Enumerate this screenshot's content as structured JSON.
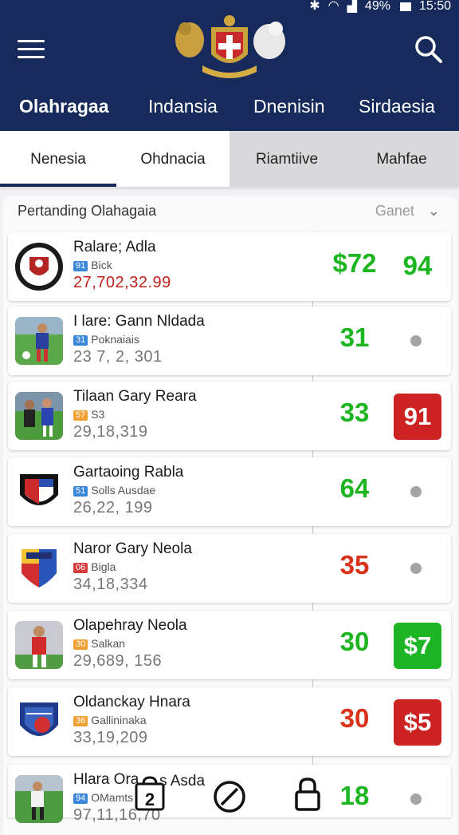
{
  "status": {
    "battery": "49%",
    "time": "15:50"
  },
  "header": {
    "menu_icon": "menu-icon",
    "search_icon": "search-icon",
    "crest_icon": "coat-of-arms",
    "tabs": [
      {
        "label": "Olahragaa",
        "active": true
      },
      {
        "label": "Indansia",
        "active": false
      },
      {
        "label": "Dnenisin",
        "active": false
      },
      {
        "label": "Sirdaesia",
        "active": false
      }
    ]
  },
  "subtabs": [
    {
      "label": "Nenesia",
      "active": true
    },
    {
      "label": "Ohdnacia",
      "active": false
    },
    {
      "label": "Riamtiive",
      "active": false
    },
    {
      "label": "Mahfae",
      "active": false
    }
  ],
  "panel": {
    "title": "Pertanding Olahagaia",
    "filter_label": "Ganet"
  },
  "rows": [
    {
      "name": "Ralare; Adla",
      "tag": "91",
      "tag_color": "#3a86d9",
      "sub": "Bick",
      "value": "27,702,32.99",
      "score": "$72",
      "score_color": "green",
      "right": "94",
      "right_type": "text",
      "logo": "club-crest"
    },
    {
      "name": "I lare: Gann Nldada",
      "tag": "31",
      "tag_color": "#3a86d9",
      "sub": "Poknaiais",
      "value": "23 7, 2, 301",
      "score": "31",
      "score_color": "green",
      "right": "",
      "right_type": "dot",
      "logo": "player-photo"
    },
    {
      "name": "Tilaan Gary Reara",
      "tag": "57",
      "tag_color": "#f0a030",
      "sub": "S3",
      "value": "29,18,319",
      "score": "33",
      "score_color": "green",
      "right": "91",
      "right_type": "badge-red",
      "logo": "player-photo"
    },
    {
      "name": "Gartaoing Rabla",
      "tag": "51",
      "tag_color": "#3a86d9",
      "sub": "Solls Ausdae",
      "value": "26,22, 199",
      "score": "64",
      "score_color": "green",
      "right": "",
      "right_type": "dot",
      "logo": "shield-crest"
    },
    {
      "name": "Naror Gary Neola",
      "tag": "06",
      "tag_color": "#d93a3a",
      "sub": "Bigla",
      "value": "34,18,334",
      "score": "35",
      "score_color": "red",
      "right": "",
      "right_type": "dot",
      "logo": "colorful-crest"
    },
    {
      "name": "Olapehray Neola",
      "tag": "30",
      "tag_color": "#f0a030",
      "sub": "Salkan",
      "value": "29,689, 156",
      "score": "30",
      "score_color": "green",
      "right": "$7",
      "right_type": "badge-green",
      "logo": "player-photo"
    },
    {
      "name": "Oldanckay Hnara",
      "tag": "36",
      "tag_color": "#f0a030",
      "sub": "Gallininaka",
      "value": "33,19,209",
      "score": "30",
      "score_color": "red",
      "right": "$5",
      "right_type": "badge-red",
      "logo": "blue-crest"
    },
    {
      "name": "Hlara Ora",
      "tag": "94",
      "tag_color": "#3a86d9",
      "sub": "OMamts",
      "value": "97,11,16,70",
      "score": "18",
      "score_color": "green",
      "right": "",
      "right_type": "dot",
      "logo": "player-photo"
    }
  ],
  "bottom_nav": {
    "items": [
      {
        "icon": "calendar-icon",
        "label": "2"
      },
      {
        "icon": "no-entry-icon",
        "label": ""
      },
      {
        "icon": "lock-icon",
        "label": ""
      }
    ],
    "overlay_text": "s Asda"
  }
}
